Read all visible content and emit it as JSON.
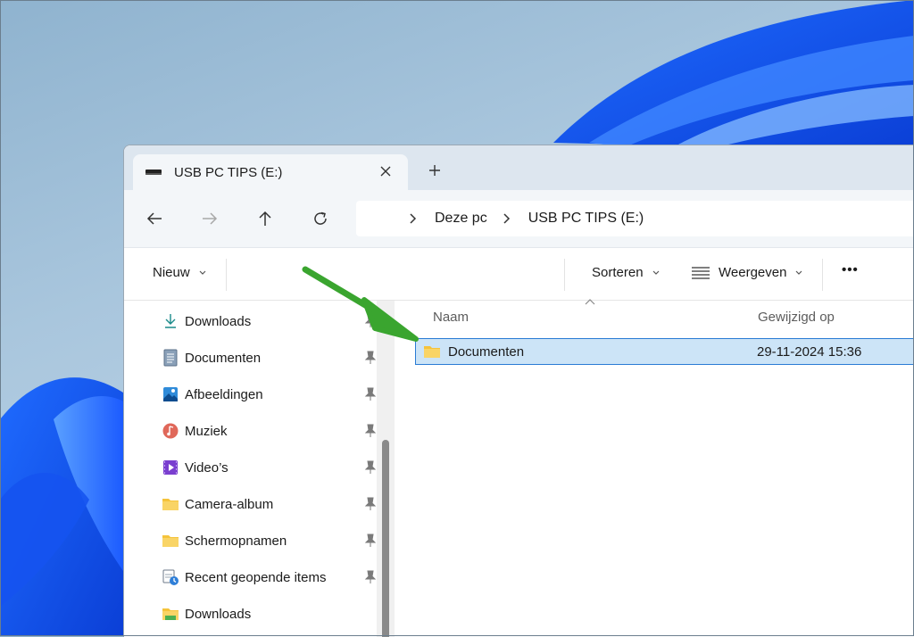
{
  "colors": {
    "accent": "#2a7bd4",
    "selection": "#cce4f7",
    "annotation_arrow": "#3aa52f",
    "folder": "#f5c33b"
  },
  "tab": {
    "title": "USB PC TIPS (E:)",
    "icon": "usb-drive-icon"
  },
  "navigation": {
    "back_icon": "arrow-left-icon",
    "forward_icon": "arrow-right-icon",
    "up_icon": "arrow-up-icon",
    "refresh_icon": "refresh-icon"
  },
  "breadcrumb": [
    "Deze pc",
    "USB PC TIPS (E:)"
  ],
  "toolbar": {
    "new_label": "Nieuw",
    "sort_label": "Sorteren",
    "view_label": "Weergeven",
    "more_label": "•••"
  },
  "sidebar": {
    "items": [
      {
        "label": "Downloads",
        "icon": "download-icon",
        "pinned": true
      },
      {
        "label": "Documenten",
        "icon": "document-icon",
        "pinned": true
      },
      {
        "label": "Afbeeldingen",
        "icon": "picture-icon",
        "pinned": true
      },
      {
        "label": "Muziek",
        "icon": "music-icon",
        "pinned": true
      },
      {
        "label": "Video’s",
        "icon": "video-icon",
        "pinned": true
      },
      {
        "label": "Camera-album",
        "icon": "folder-icon",
        "pinned": true
      },
      {
        "label": "Schermopnamen",
        "icon": "folder-icon",
        "pinned": true
      },
      {
        "label": "Recent geopende items",
        "icon": "recent-icon",
        "pinned": true
      },
      {
        "label": "Downloads",
        "icon": "folder-icon",
        "pinned": false
      }
    ]
  },
  "columns": {
    "name": "Naam",
    "modified": "Gewijzigd op"
  },
  "files": [
    {
      "name": "Documenten",
      "modified": "29-11-2024 15:36",
      "icon": "folder-icon",
      "selected": true
    }
  ]
}
